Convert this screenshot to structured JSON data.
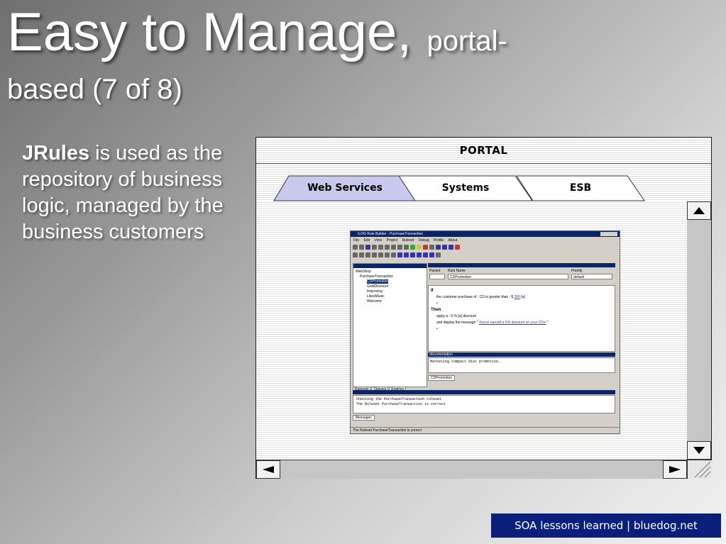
{
  "slide": {
    "title_main": "Easy to Manage,",
    "title_sub": "portal-",
    "title_line2": "based (7 of 8)",
    "body_bold": "JRules",
    "body_rest": " is used as the repository of business logic, managed by the business customers",
    "footer": "SOA lessons learned | bluedog.net"
  },
  "portal": {
    "title": "PORTAL",
    "tabs": [
      {
        "label": "Web Services",
        "active": true
      },
      {
        "label": "Systems",
        "active": false
      },
      {
        "label": "ESB",
        "active": false
      }
    ],
    "scroll_icons": [
      "arrow-up-icon",
      "arrow-down-icon",
      "arrow-left-icon",
      "arrow-right-icon"
    ]
  },
  "rule_builder": {
    "window_title": "ILOG Rule Builder - PurchaseTransaction",
    "menu": [
      "File",
      "Edit",
      "View",
      "Project",
      "Ruleset",
      "Debug",
      "Profile",
      "About"
    ],
    "tree": [
      "WebShop",
      "PurchaseTransaction",
      "CDPromotion",
      "GoldDiscount",
      "Improving",
      "LikesMusic",
      "Welcome"
    ],
    "left_tabs": [
      "Rulesets",
      "Classes",
      "Engines"
    ],
    "fields": {
      "packet_label": "Packet",
      "rule_name_label": "Rule Name",
      "rule_name_value": "CDPromotion",
      "priority_label": "Priority",
      "priority_value": "default"
    },
    "editor": {
      "if_kw": "If",
      "if_line": "the customer purchase of : CD is greater than : $",
      "if_amount": "200",
      "if_suffix": " [a]",
      "then_kw": "Then",
      "then_line1": "apply a : 5 % [a] discount",
      "then_line2_prefix": "and display the message \" ",
      "then_message": "You've earned a 5% discount on your CDs!",
      "then_line2_suffix": " \""
    },
    "documentation_label": "documentation",
    "documentation_text": "Marketing compact disc promotion.",
    "doc_tab": "CDPromotion",
    "messages": [
      "Checking the PurchaseTransaction ruleset",
      "The Ruleset PurchaseTransaction is correct"
    ],
    "messages_tab": "Messages",
    "status": "The Ruleset PurchaseTransaction is correct"
  }
}
